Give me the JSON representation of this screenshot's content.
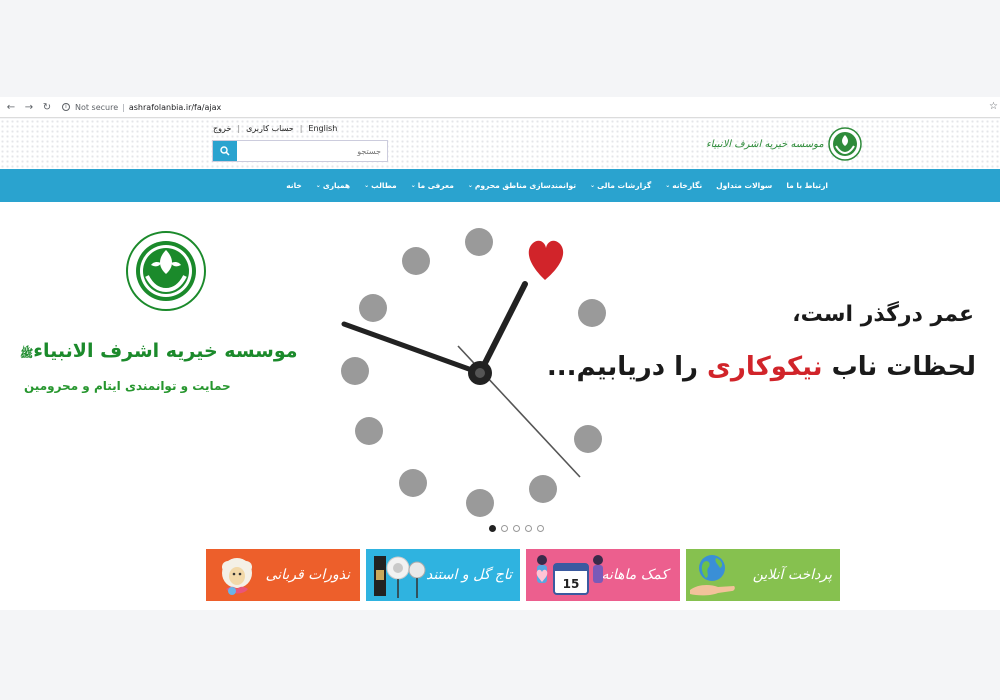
{
  "browser": {
    "security_label": "Not secure",
    "url": "ashrafolanbia.ir/fa/ajax",
    "back_icon": "arrow-left-icon",
    "forward_icon": "arrow-right-icon",
    "reload_icon": "reload-icon"
  },
  "header": {
    "top_links": [
      "English",
      "حساب کاربری",
      "خروج"
    ],
    "search_placeholder": "جستجو",
    "logo_text": "موسسه خیریه اشرف الانبیاء"
  },
  "nav": {
    "items": [
      {
        "label": "خانه",
        "dropdown": false
      },
      {
        "label": "همیاری",
        "dropdown": true
      },
      {
        "label": "مطالب",
        "dropdown": true
      },
      {
        "label": "معرفی ما",
        "dropdown": true
      },
      {
        "label": "توانمندسازی مناطق محروم",
        "dropdown": true
      },
      {
        "label": "گزارشات مالی",
        "dropdown": true
      },
      {
        "label": "نگارخانه",
        "dropdown": true
      },
      {
        "label": "سوالات متداول",
        "dropdown": false
      },
      {
        "label": "ارتباط با ما",
        "dropdown": false
      }
    ]
  },
  "hero": {
    "org_name": "موسسه خیریه اشرف الانبیاء",
    "org_name_suffix": "ﷺ",
    "org_tagline": "حمایت و توانمندی ایتام و محرومین",
    "line1": "عمر درگذر است،",
    "line2_prefix": "لحظات ناب ",
    "line2_highlight": "نیکوکاری",
    "line2_suffix": " را دریابیم...",
    "slide_count": 5,
    "active_slide": 1,
    "accent_color": "#d1242a"
  },
  "banners": [
    {
      "label": "نذورات قربانی",
      "color": "#ed5f2b",
      "icon": "sheep-icon"
    },
    {
      "label": "تاج گل و استند",
      "color": "#2fb3e0",
      "icon": "flower-stand-icon"
    },
    {
      "label": "کمک ماهانه",
      "color": "#ec5f8e",
      "icon": "calendar-icon",
      "calendar_day": "15"
    },
    {
      "label": "پرداخت آنلاین",
      "color": "#86c14f",
      "icon": "globe-hand-icon"
    }
  ],
  "colors": {
    "primary": "#2aa3cf",
    "green": "#1b8a2b"
  }
}
